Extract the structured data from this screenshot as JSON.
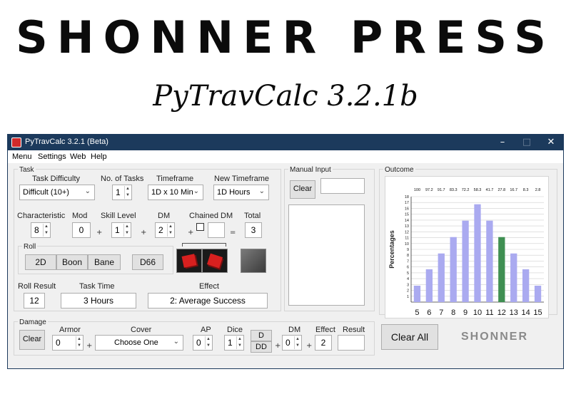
{
  "banner": {
    "title": "SHONNER PRESS",
    "subtitle": "PyTravCalc 3.2.1b"
  },
  "window": {
    "title": "PyTravCalc 3.2.1 (Beta)",
    "controls": {
      "minimize": "–",
      "maximize": "□",
      "close": "✕"
    }
  },
  "menu": [
    "Menu",
    "Settings",
    "Web",
    "Help"
  ],
  "task": {
    "group_label": "Task",
    "difficulty": {
      "label": "Task Difficulty",
      "value": "Difficult (10+)"
    },
    "num_tasks": {
      "label": "No. of Tasks",
      "value": "1"
    },
    "timeframe": {
      "label": "Timeframe",
      "value": "1D x 10 Min"
    },
    "new_timeframe": {
      "label": "New Timeframe",
      "value": "1D Hours"
    },
    "characteristic": {
      "label": "Characteristic",
      "value": "8"
    },
    "mod": {
      "label": "Mod",
      "value": "0"
    },
    "skill_level": {
      "label": "Skill Level",
      "value": "1"
    },
    "dm": {
      "label": "DM",
      "value": "2"
    },
    "chained_dm": {
      "label": "Chained DM",
      "value": ""
    },
    "total": {
      "label": "Total",
      "value": "3"
    },
    "roll": {
      "label": "Roll",
      "buttons": [
        "2D",
        "Boon",
        "Bane",
        "D66"
      ]
    },
    "roll_result": {
      "label": "Roll Result",
      "value": "12"
    },
    "task_time": {
      "label": "Task Time",
      "value": "3 Hours"
    },
    "effect": {
      "label": "Effect",
      "value": "2: Average Success"
    }
  },
  "manual_input": {
    "label": "Manual Input",
    "clear": "Clear",
    "value": ""
  },
  "damage": {
    "label": "Damage",
    "clear": "Clear",
    "armor": {
      "label": "Armor",
      "value": "0"
    },
    "cover": {
      "label": "Cover",
      "value": "Choose One"
    },
    "ap": {
      "label": "AP",
      "value": "0"
    },
    "dice": {
      "label": "Dice",
      "value": "1"
    },
    "d_button": "D",
    "dd_button": "DD",
    "dm": {
      "label": "DM",
      "value": "0"
    },
    "effect": {
      "label": "Effect",
      "value": "2"
    },
    "result": {
      "label": "Result",
      "value": ""
    }
  },
  "clear_all": "Clear All",
  "logo_text": "SHONNER",
  "ops": {
    "plus": "+",
    "eq": "="
  },
  "colors": {
    "bar": "#aaaaf0",
    "highlight": "#3f8f52",
    "titlebar": "#1c3a5c"
  },
  "chart_data": {
    "type": "bar",
    "title": "Outcome",
    "ylabel": "Percentages",
    "xlabel": "",
    "categories": [
      "5",
      "6",
      "7",
      "8",
      "9",
      "10",
      "11",
      "12",
      "13",
      "14",
      "15"
    ],
    "values": [
      2.8,
      5.6,
      8.3,
      11.1,
      13.9,
      16.7,
      13.9,
      11.1,
      8.3,
      5.6,
      2.8
    ],
    "top_labels": [
      "100",
      "97.2",
      "91.7",
      "83.3",
      "72.2",
      "58.3",
      "41.7",
      "27.8",
      "16.7",
      "8.3",
      "2.8"
    ],
    "highlight_category": "12",
    "ylim": [
      0,
      18
    ],
    "yticks": [
      "1",
      "2",
      "3",
      "4",
      "5",
      "6",
      "7",
      "8",
      "9",
      "10",
      "11",
      "12",
      "13",
      "14",
      "15",
      "16",
      "17",
      "18"
    ],
    "grid": true
  }
}
